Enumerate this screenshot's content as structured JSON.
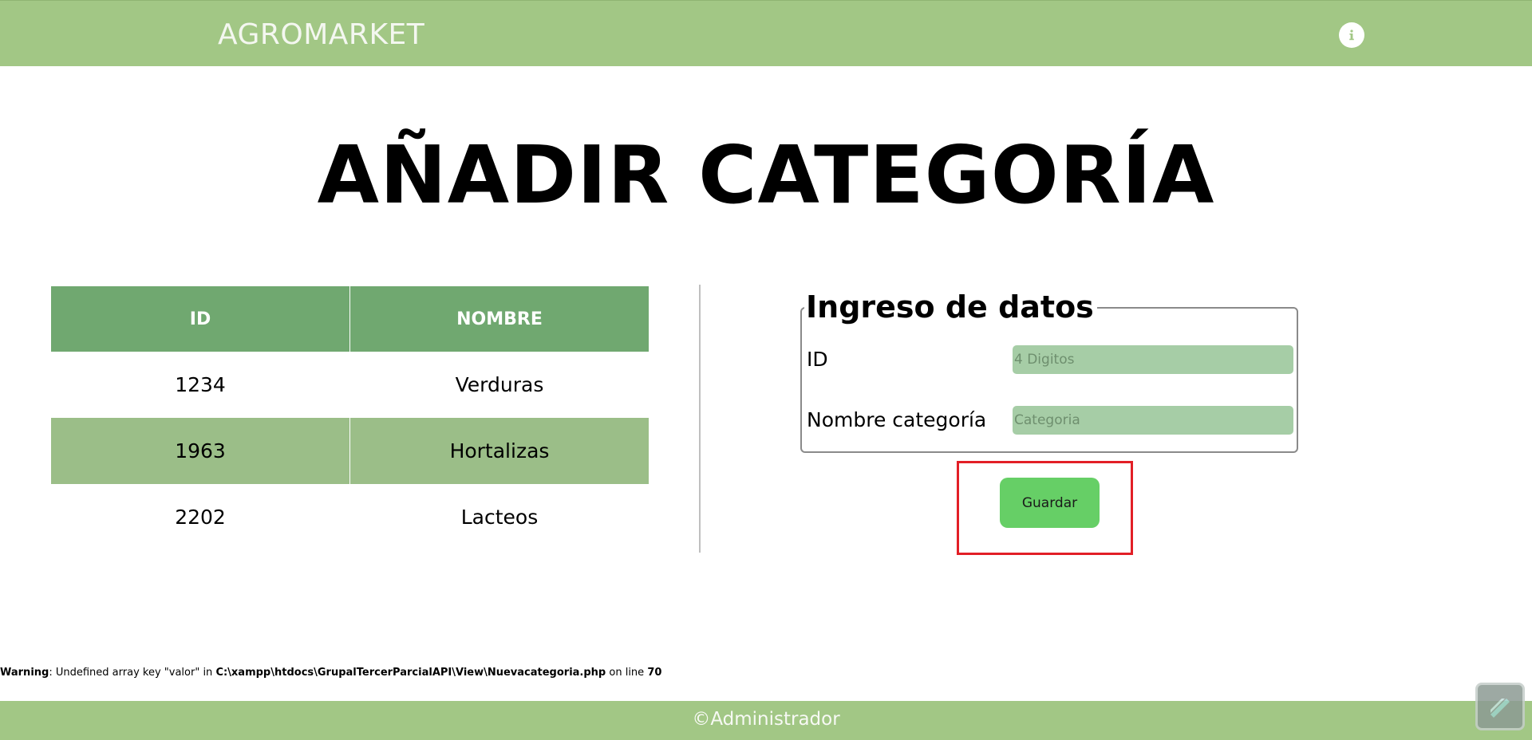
{
  "header": {
    "brand": "AGROMARKET",
    "info_icon": "info-icon"
  },
  "page_title": "AÑADIR CATEGORÍA",
  "table": {
    "headers": [
      "ID",
      "NOMBRE"
    ],
    "rows": [
      [
        "1234",
        "Verduras"
      ],
      [
        "1963",
        "Hortalizas"
      ],
      [
        "2202",
        "Lacteos"
      ]
    ]
  },
  "form": {
    "legend": "Ingreso de datos",
    "id_label": "ID",
    "id_placeholder": "4 Digitos",
    "id_value": "",
    "name_label": "Nombre categoría",
    "name_placeholder": "Categoria",
    "name_value": "",
    "save_label": "Guardar"
  },
  "warning": {
    "prefix": "Warning",
    "message": ": Undefined array key \"valor\" in ",
    "path": "C:\\xampp\\htdocs\\GrupalTercerParcialAPI\\View\\Nuevacategoria.php",
    "line_text": " on line ",
    "line_number": "70"
  },
  "footer": {
    "text": "©Administrador"
  },
  "colors": {
    "header_bg": "#a2c785",
    "table_header_bg": "#70a870",
    "table_alt_row_bg": "#9bbe88",
    "input_bg": "#a6cda6",
    "button_bg": "#66cf66",
    "highlight_border": "#e21f26"
  }
}
